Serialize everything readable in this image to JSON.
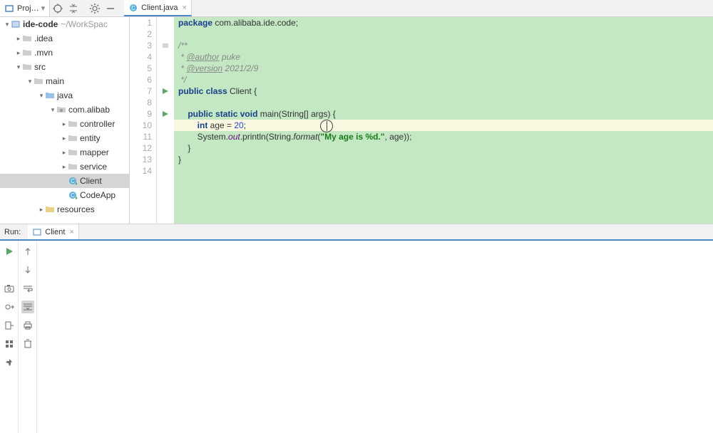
{
  "toolbar": {
    "project_tab": "Proj…",
    "editor_tab": "Client.java"
  },
  "tree": {
    "root": "ide-code",
    "root_suffix": "~/WorkSpac",
    "idea": ".idea",
    "mvn": ".mvn",
    "src": "src",
    "main": "main",
    "java": "java",
    "pkg": "com.alibab",
    "controller": "controller",
    "entity": "entity",
    "mapper": "mapper",
    "service": "service",
    "client": "Client",
    "codeapp": "CodeApp",
    "resources": "resources"
  },
  "code": {
    "lines": [
      "1",
      "2",
      "3",
      "4",
      "5",
      "6",
      "7",
      "8",
      "9",
      "10",
      "11",
      "12",
      "13",
      "14"
    ],
    "l1_kw": "package",
    "l1_rest": " com.alibaba.ide.code;",
    "l3": "/**",
    "l4a": " * ",
    "l4tag": "@author",
    "l4b": " puke",
    "l5a": " * ",
    "l5tag": "@version",
    "l5b": " 2021/2/9",
    "l6": " */",
    "l7a": "public",
    "l7b": "class",
    "l7c": " Client {",
    "l9a": "public",
    "l9b": "static",
    "l9c": "void",
    "l9d": " main(String[] args) {",
    "l10a": "int",
    "l10b": " age = ",
    "l10n": "20",
    "l10c": ";",
    "l11a": "System.",
    "l11f": "out",
    "l11b": ".println(String.",
    "l11fn": "format",
    "l11c": "(",
    "l11s": "\"My age is %d.\"",
    "l11d": ", age));",
    "l12": "}",
    "l13": "}"
  },
  "run": {
    "label": "Run:",
    "tab": "Client"
  }
}
